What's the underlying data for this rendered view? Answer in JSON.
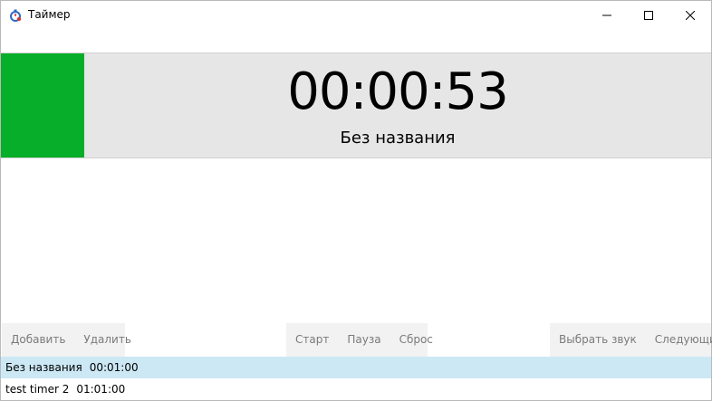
{
  "window": {
    "title": "Таймер",
    "icon": "stopwatch-icon",
    "controls": [
      "minimize-icon",
      "maximize-icon",
      "close-icon"
    ]
  },
  "display": {
    "time": "00:00:53",
    "name": "Без названия",
    "status_color": "#07ae2a"
  },
  "toolbar": {
    "add_label": "Добавить",
    "delete_label": "Удалить",
    "start_label": "Старт",
    "pause_label": "Пауза",
    "reset_label": "Сброс",
    "choose_sound_label": "Выбрать звук",
    "next_label": "Следующий"
  },
  "timers": [
    {
      "name": "Без названия",
      "duration": "00:01:00",
      "selected": true
    },
    {
      "name": "test timer 2",
      "duration": "01:01:00",
      "selected": false
    }
  ],
  "colors": {
    "selection": "#cce8f5",
    "display_bg": "#e6e6e6",
    "toolbar_bg": "#f2f2f2"
  }
}
